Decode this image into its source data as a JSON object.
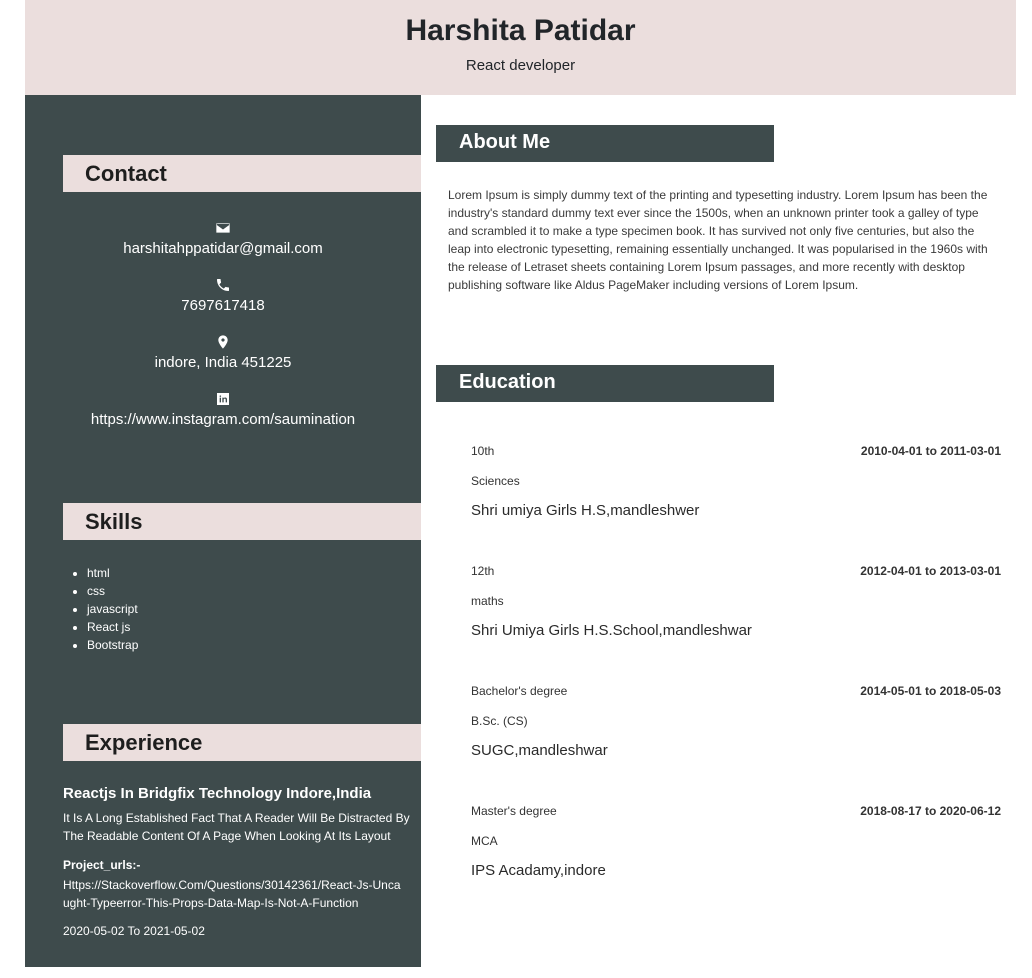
{
  "header": {
    "name": "Harshita Patidar",
    "role": "React developer"
  },
  "sidebar": {
    "contact_heading": "Contact",
    "contact": [
      {
        "icon": "mail-icon",
        "text": "harshitahppatidar@gmail.com"
      },
      {
        "icon": "phone-icon",
        "text": "7697617418"
      },
      {
        "icon": "location-pin-icon",
        "text": "indore, India 451225"
      },
      {
        "icon": "linkedin-icon",
        "text": "https://www.instagram.com/saumination"
      }
    ],
    "skills_heading": "Skills",
    "skills": [
      "html",
      "css",
      "javascript",
      "React js",
      "Bootstrap"
    ],
    "experience_heading": "Experience",
    "experience": {
      "title": "Reactjs In Bridgfix Technology Indore,India",
      "description": "It Is A Long Established Fact That A Reader Will Be Distracted By The Readable Content Of A Page When Looking At Its Layout",
      "project_label": "Project_urls:-",
      "project_url": "Https://Stackoverflow.Com/Questions/30142361/React-Js-Uncaught-Typeerror-This-Props-Data-Map-Is-Not-A-Function",
      "dates": "2020-05-02 To 2021-05-02"
    }
  },
  "main": {
    "about_heading": "About Me",
    "about_text": "Lorem Ipsum is simply dummy text of the printing and typesetting industry. Lorem Ipsum has been the industry's standard dummy text ever since the 1500s, when an unknown printer took a galley of type and scrambled it to make a type specimen book. It has survived not only five centuries, but also the leap into electronic typesetting, remaining essentially unchanged. It was popularised in the 1960s with the release of Letraset sheets containing Lorem Ipsum passages, and more recently with desktop publishing software like Aldus PageMaker including versions of Lorem Ipsum.",
    "education_heading": "Education",
    "education": [
      {
        "level": "10th",
        "dates": "2010-04-01 to 2011-03-01",
        "field": "Sciences",
        "school": "Shri umiya Girls H.S,mandleshwer"
      },
      {
        "level": "12th",
        "dates": "2012-04-01 to 2013-03-01",
        "field": "maths",
        "school": "Shri Umiya Girls H.S.School,mandleshwar"
      },
      {
        "level": "Bachelor's degree",
        "dates": "2014-05-01 to 2018-05-03",
        "field": "B.Sc. (CS)",
        "school": "SUGC,mandleshwar"
      },
      {
        "level": "Master's degree",
        "dates": "2018-08-17 to 2020-06-12",
        "field": "MCA",
        "school": "IPS Acadamy,indore"
      }
    ]
  },
  "colors": {
    "sidebar_bg": "#3e4b4c",
    "header_bg": "#ebdedd",
    "accent_text": "#ffffff"
  }
}
